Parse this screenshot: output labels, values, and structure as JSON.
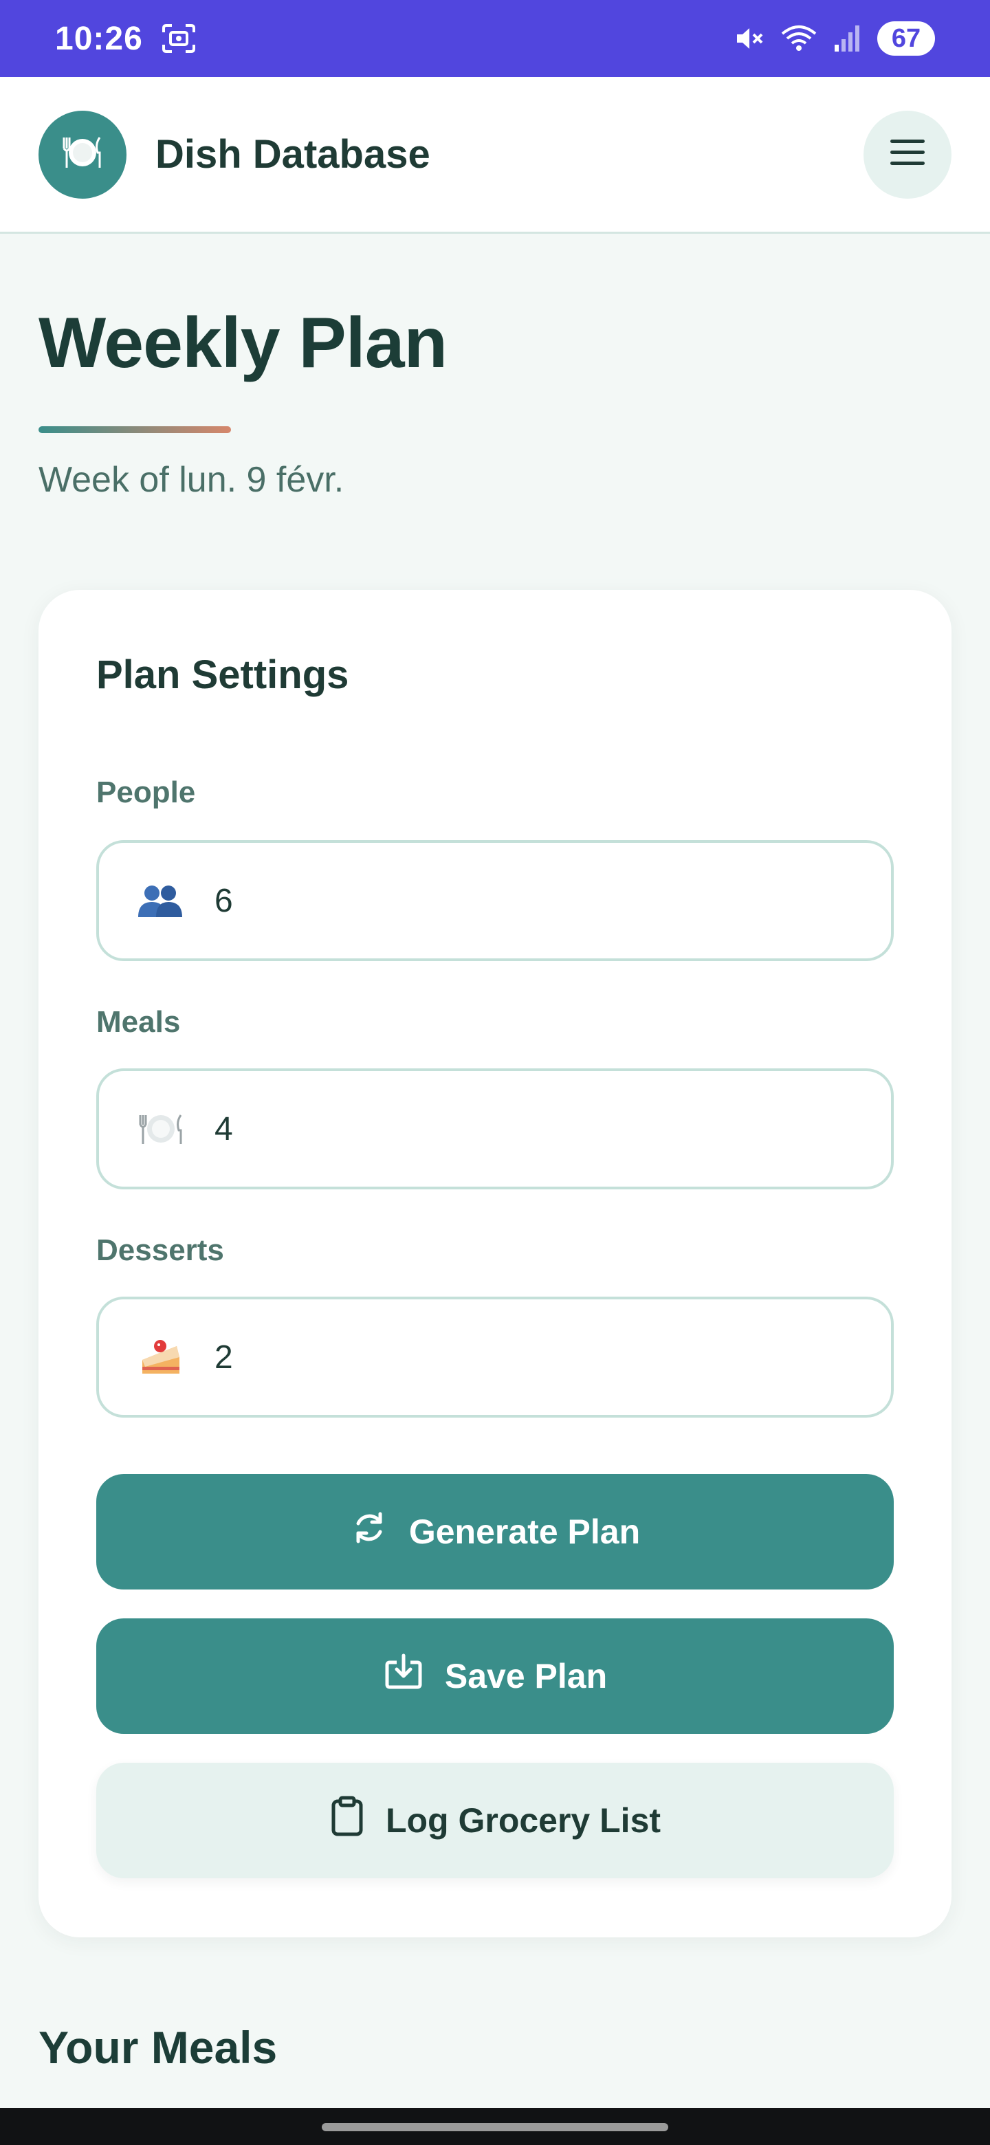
{
  "status_bar": {
    "time": "10:26",
    "battery": "67"
  },
  "header": {
    "app_title": "Dish Database"
  },
  "page": {
    "title": "Weekly Plan",
    "subtitle": "Week of lun. 9 févr."
  },
  "settings": {
    "title": "Plan Settings",
    "fields": [
      {
        "label": "People",
        "value": "6",
        "icon": "people-icon"
      },
      {
        "label": "Meals",
        "value": "4",
        "icon": "plate-icon"
      },
      {
        "label": "Desserts",
        "value": "2",
        "icon": "cake-icon"
      }
    ],
    "buttons": {
      "generate": "Generate Plan",
      "save": "Save Plan",
      "log": "Log Grocery List"
    }
  },
  "meals_section": {
    "title": "Your Meals"
  },
  "colors": {
    "status_bar": "#5146de",
    "primary": "#3a8e8a",
    "secondary_bg": "#e6f2ef",
    "accent_gradient_end": "#d6876b"
  }
}
